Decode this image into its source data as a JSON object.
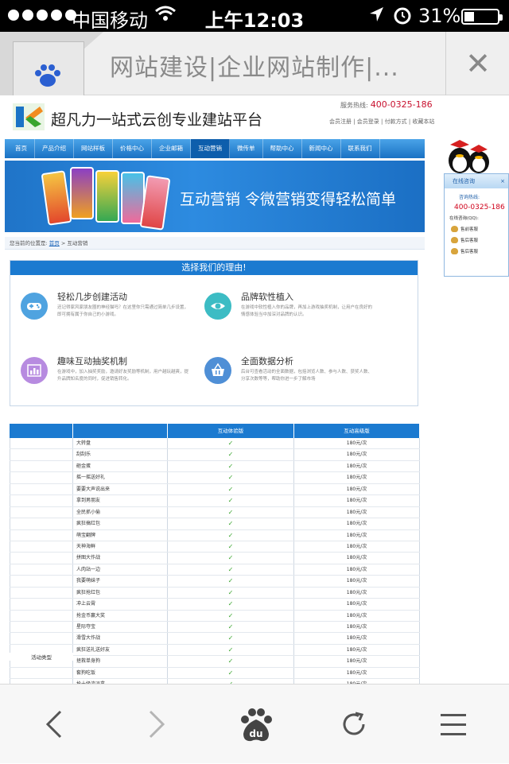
{
  "status_bar": {
    "carrier": "中国移动",
    "time": "上午12:03",
    "battery": "31%",
    "battery_level": 0.31
  },
  "browser": {
    "tab_title": "网站建设|企业网站制作|...",
    "toolbar_icons": [
      "back-icon",
      "forward-icon",
      "baidu-du-icon",
      "refresh-icon",
      "menu-icon"
    ]
  },
  "site": {
    "title": "超凡力一站式云创专业建站平台",
    "hotline_label": "服务热线:",
    "hotline_number": "400-0325-186",
    "top_links": "会员注册 | 会员登录 | 付款方式 | 收藏本站",
    "nav": [
      "首页",
      "产品介绍",
      "网站样板",
      "价格中心",
      "企业邮箱",
      "互动营销",
      "微传单",
      "帮助中心",
      "新闻中心",
      "联系我们"
    ],
    "nav_active": "互动营销",
    "banner_slogan": "互动营销  令微营销变得轻松简单",
    "breadcrumb_prefix": "您当前的位置是:",
    "breadcrumb_home": "首页",
    "breadcrumb_current": "> 互动营销"
  },
  "reasons": {
    "heading": "选择我们的理由!",
    "items": [
      {
        "title": "轻松几步创建活动",
        "desc": "还记得家风家朋友圈的神经猫吗？在这里你只需通过简单几步设置，即可拥有属于你自己的小游戏。",
        "icon": "gamepad-icon",
        "color": "#4fa3e0"
      },
      {
        "title": "品牌软性植入",
        "desc": "在游戏中软性植入你的品牌，再加上游戏抽奖机制，让用户在良好的情感体验当中加深对品牌的认识。",
        "icon": "eye-icon",
        "color": "#3cbcc4"
      },
      {
        "title": "趣味互动抽奖机制",
        "desc": "在游戏中，加入抽奖奖励，邀请好友奖励等机制，用户越玩越爽，提升品牌知名度的同时，促进销售转化。",
        "icon": "chart-icon",
        "color": "#b78be0"
      },
      {
        "title": "全面数据分析",
        "desc": "后台可查看活动的全面数据，包括浏览人数、参与人数、获奖人数、分享次数等等，帮助你进一步了解市场",
        "icon": "basket-icon",
        "color": "#4f8fd6"
      }
    ]
  },
  "compare_table": {
    "headers": [
      "",
      "",
      "互动体验版",
      "互动高级版"
    ],
    "category": "活动类型",
    "price": "180元/次",
    "check": "✓",
    "rows": [
      "大转盘",
      "刮刮乐",
      "砸金蛋",
      "摇一摇送好礼",
      "要要大声说出来",
      "拿到男朋友",
      "全民抓小偷",
      "疯狂搞红包",
      "萌宝翻牌",
      "天神海鲜",
      "拼图大作战",
      "人肉站一边",
      "我要萌妹子",
      "疯狂抢红包",
      "冲上云霄",
      "抢金币赢大奖",
      "星际夺宝",
      "滑雪大作战",
      "疯狂送礼送好友",
      "拯救单身狗",
      "套狗吃饭",
      "抢十级流派拿"
    ]
  },
  "qq_panel": {
    "title": "在线咨询",
    "close": "×",
    "hotline": "咨询热线:",
    "number": "400-0325-186",
    "service_label": "在线咨询(QQ):",
    "services": [
      "售前客服",
      "售后客服",
      "售后客服"
    ]
  }
}
